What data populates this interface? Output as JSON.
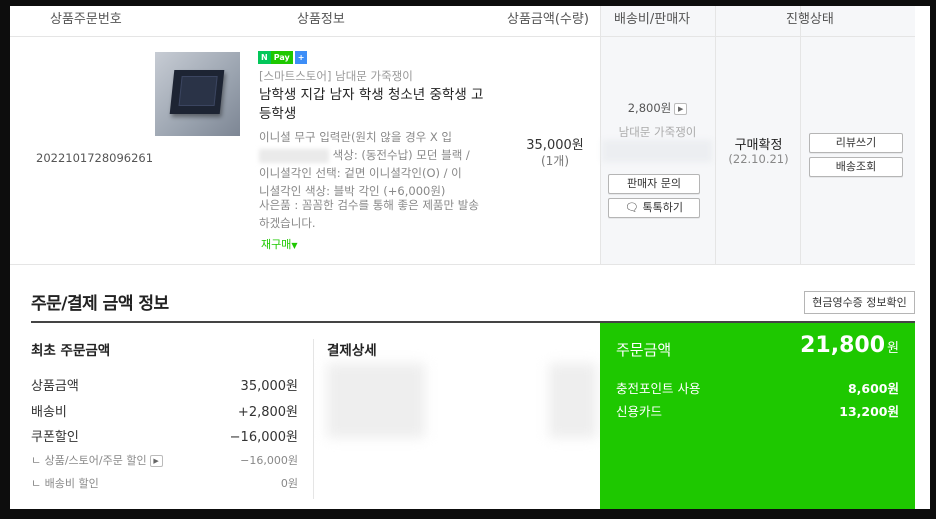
{
  "table": {
    "headers": {
      "order_no": "상품주문번호",
      "product_info": "상품정보",
      "amount_qty": "상품금액(수량)",
      "shipping_seller": "배송비/판매자",
      "status": "진행상태"
    }
  },
  "order": {
    "order_no": "2022101728096261",
    "npay_n": "N",
    "npay_pay": "Pay",
    "npay_plus": "+",
    "store": "[스마트스토어] 남대문 가죽쟁이",
    "product_name": "남학생 지갑 남자 학생 청소년 중학생 고등학생",
    "option_line1": "이니셜 무구 입력란(원치 않을 경우 X 입",
    "option_line2": "색상: (동전수납) 모던 블랙 /",
    "option_line3": "이니셜각인 선택: 겉면 이니셜각인(O) / 이",
    "option_line4": "니셜각인 색상: 블박 각인 (+6,000원)",
    "gift": "사은품 : 꼼꼼한 검수를 통해 좋은 제품만 발송하겠습니다.",
    "rebuy": "재구매",
    "price": "35,000원",
    "qty": "(1개)",
    "shipping_fee": "2,800원",
    "seller": "남대문 가죽쟁이",
    "btn_seller_inquiry": "판매자 문의",
    "btn_talk": "톡톡하기",
    "status": "구매확정",
    "status_date": "(22.10.21)",
    "btn_review": "리뷰쓰기",
    "btn_tracking": "배송조회"
  },
  "payment": {
    "section_title": "주문/결제 금액 정보",
    "receipt_button": "현금영수증 정보확인",
    "initial": {
      "title": "최초 주문금액",
      "rows": [
        {
          "label": "상품금액",
          "value": "35,000원"
        },
        {
          "label": "배송비",
          "value": "+2,800원"
        },
        {
          "label": "쿠폰할인",
          "value": "−16,000원"
        }
      ],
      "sub_rows": [
        {
          "label": "ㄴ 상품/스토어/주문 할인",
          "value": "−16,000원"
        },
        {
          "label": "ㄴ 배송비 할인",
          "value": "0원"
        }
      ]
    },
    "detail": {
      "title": "결제상세"
    },
    "summary": {
      "label": "주문금액",
      "total": "21,800",
      "total_unit": "원",
      "rows": [
        {
          "label": "충전포인트 사용",
          "value": "8,600원"
        },
        {
          "label": "신용카드",
          "value": "13,200원"
        }
      ]
    }
  },
  "colors": {
    "accent_green": "#1ec800",
    "npay_green": "#03c75a"
  }
}
